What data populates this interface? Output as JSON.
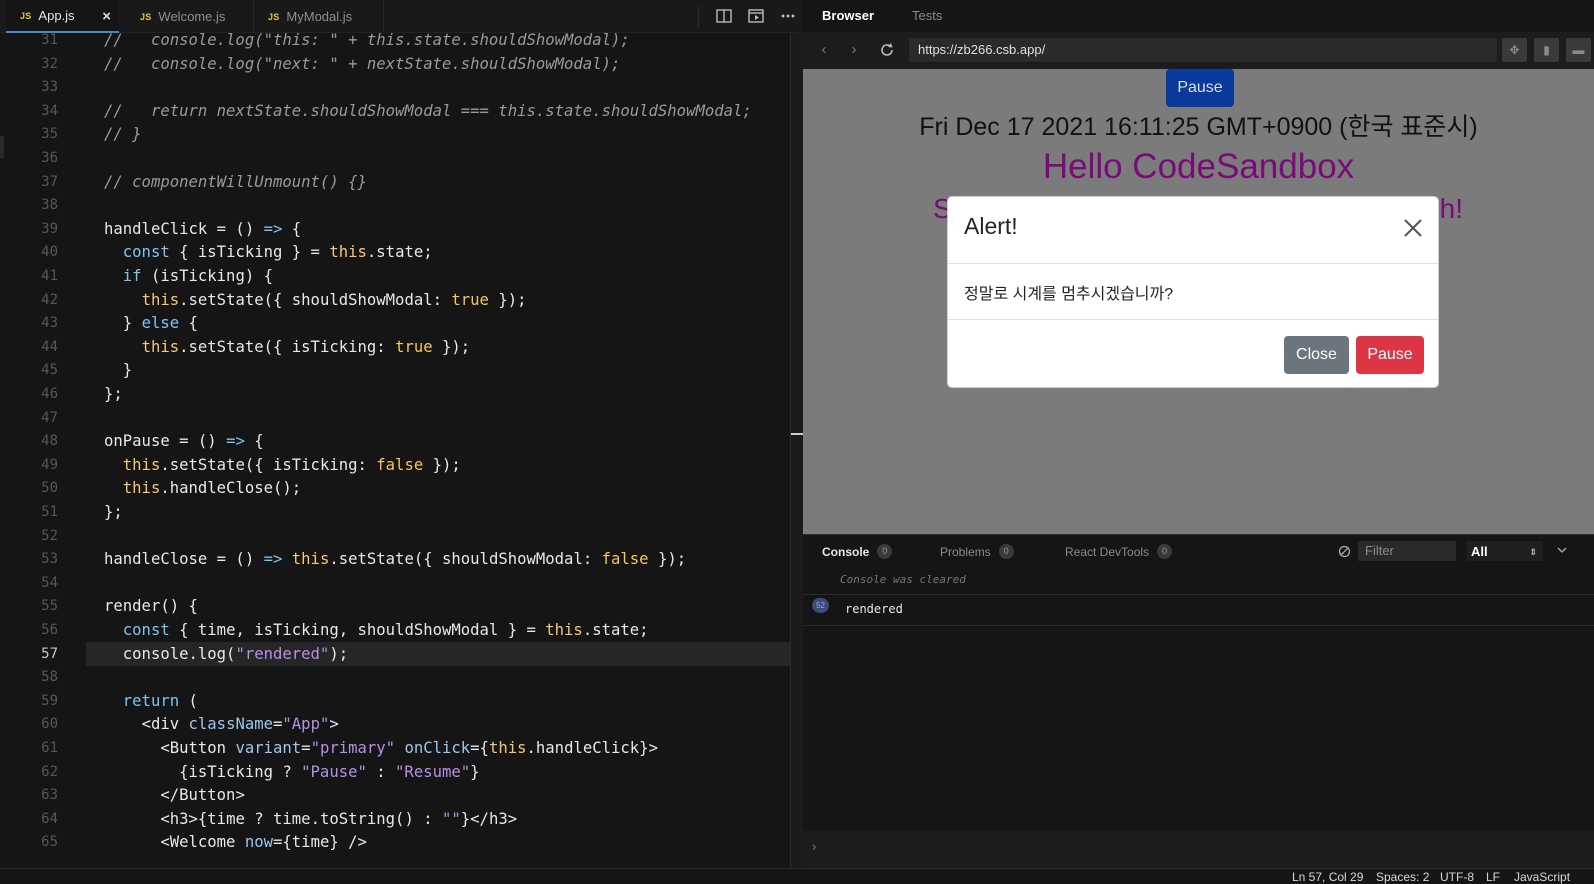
{
  "editor": {
    "tabs": [
      {
        "badge": "JS",
        "label": "App.js",
        "close": "×"
      },
      {
        "badge": "JS",
        "label": "Welcome.js"
      },
      {
        "badge": "JS",
        "label": "MyModal.js"
      }
    ],
    "toolbar_icons": [
      "split-editor-icon",
      "preview-icon",
      "more-icon"
    ],
    "code_lines": [
      {
        "n": "31",
        "t": "//   console.log(\"this: \" + this.state.shouldShowModal);"
      },
      {
        "n": "32",
        "t": "//   console.log(\"next: \" + nextState.shouldShowModal);"
      },
      {
        "n": "33",
        "t": ""
      },
      {
        "n": "34",
        "t": "//   return nextState.shouldShowModal === this.state.shouldShowModal;"
      },
      {
        "n": "35",
        "t": "// }"
      },
      {
        "n": "36",
        "t": ""
      },
      {
        "n": "37",
        "t": "// componentWillUnmount() {}"
      },
      {
        "n": "38",
        "t": ""
      },
      {
        "n": "39",
        "t": "handleClick = () => {"
      },
      {
        "n": "40",
        "t": "  const { isTicking } = this.state;"
      },
      {
        "n": "41",
        "t": "  if (isTicking) {"
      },
      {
        "n": "42",
        "t": "    this.setState({ shouldShowModal: true });"
      },
      {
        "n": "43",
        "t": "  } else {"
      },
      {
        "n": "44",
        "t": "    this.setState({ isTicking: true });"
      },
      {
        "n": "45",
        "t": "  }"
      },
      {
        "n": "46",
        "t": "};"
      },
      {
        "n": "47",
        "t": ""
      },
      {
        "n": "48",
        "t": "onPause = () => {"
      },
      {
        "n": "49",
        "t": "  this.setState({ isTicking: false });"
      },
      {
        "n": "50",
        "t": "  this.handleClose();"
      },
      {
        "n": "51",
        "t": "};"
      },
      {
        "n": "52",
        "t": ""
      },
      {
        "n": "53",
        "t": "handleClose = () => this.setState({ shouldShowModal: false });"
      },
      {
        "n": "54",
        "t": ""
      },
      {
        "n": "55",
        "t": "render() {"
      },
      {
        "n": "56",
        "t": "  const { time, isTicking, shouldShowModal } = this.state;"
      },
      {
        "n": "57",
        "t": "  console.log(\"rendered\");"
      },
      {
        "n": "58",
        "t": ""
      },
      {
        "n": "59",
        "t": "  return ("
      },
      {
        "n": "60",
        "t": "    <div className=\"App\">"
      },
      {
        "n": "61",
        "t": "      <Button variant=\"primary\" onClick={this.handleClick}>"
      },
      {
        "n": "62",
        "t": "        {isTicking ? \"Pause\" : \"Resume\"}"
      },
      {
        "n": "63",
        "t": "      </Button>"
      },
      {
        "n": "64",
        "t": "      <h3>{time ? time.toString() : \"\"}</h3>"
      },
      {
        "n": "65",
        "t": "      <Welcome now={time} />"
      }
    ],
    "current_line": "57"
  },
  "browser": {
    "tabs": [
      "Browser",
      "Tests"
    ],
    "active_tab": "Browser",
    "url": "https://zb266.csb.app/",
    "page": {
      "pause_button": "Pause",
      "time": "Fri Dec 17 2021 16:11:25 GMT+0900 (한국 표준시)",
      "hello": "Hello CodeSandbox",
      "sub_start": "S",
      "sub_end": "h!"
    },
    "modal": {
      "title": "Alert!",
      "body": "정말로 시계를 멈추시겠습니까?",
      "close_button": "Close",
      "pause_button": "Pause"
    }
  },
  "console": {
    "tabs": [
      {
        "label": "Console",
        "count": "0"
      },
      {
        "label": "Problems",
        "count": "0"
      },
      {
        "label": "React DevTools",
        "count": "0"
      }
    ],
    "filter_placeholder": "Filter",
    "level": "All",
    "cleared_text": "Console was cleared",
    "entries": [
      {
        "count": "52",
        "message": "rendered"
      }
    ],
    "prompt": "›"
  },
  "status_bar": {
    "position": "Ln 57, Col 29",
    "spaces": "Spaces: 2",
    "encoding": "UTF-8",
    "eol": "LF",
    "language": "JavaScript"
  },
  "colors": {
    "comment": "#9a9a9a",
    "keyword": "#7ec4ef",
    "string": "#b292e5",
    "this": "#f7c67a",
    "boolean": "#f6c55c",
    "danger": "#dc3545",
    "secondary": "#6c757d",
    "primary_dark": "#0a3a9c",
    "brand": "#7a0a7a"
  }
}
